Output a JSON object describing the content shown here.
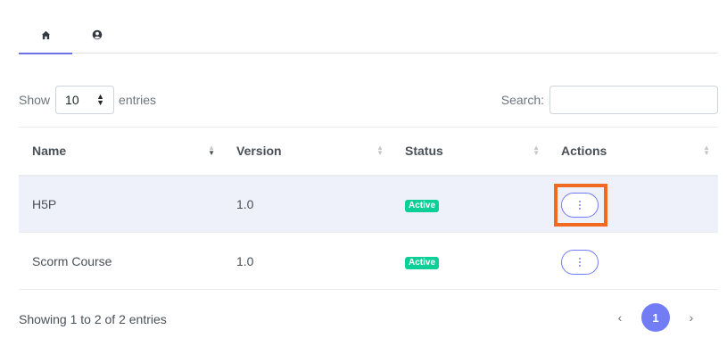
{
  "tabs": [
    {
      "icon": "home-icon",
      "active": true
    },
    {
      "icon": "user-circle-icon",
      "active": false
    }
  ],
  "length": {
    "show_label": "Show",
    "selected": "10",
    "entries_label": "entries"
  },
  "search": {
    "label": "Search:",
    "value": "",
    "placeholder": ""
  },
  "table": {
    "columns": [
      "Name",
      "Version",
      "Status",
      "Actions"
    ],
    "rows": [
      {
        "name": "H5P",
        "version": "1.0",
        "status": "Active",
        "highlighted": true
      },
      {
        "name": "Scorm Course",
        "version": "1.0",
        "status": "Active",
        "highlighted": false
      }
    ]
  },
  "info": "Showing 1 to 2 of 2 entries",
  "pagination": {
    "prev": "‹",
    "current": "1",
    "next": "›"
  },
  "colors": {
    "accent": "#727cf5",
    "status_active": "#0acf97",
    "focus_ring": "#f26a21",
    "highlight_row": "#eef1f9"
  }
}
